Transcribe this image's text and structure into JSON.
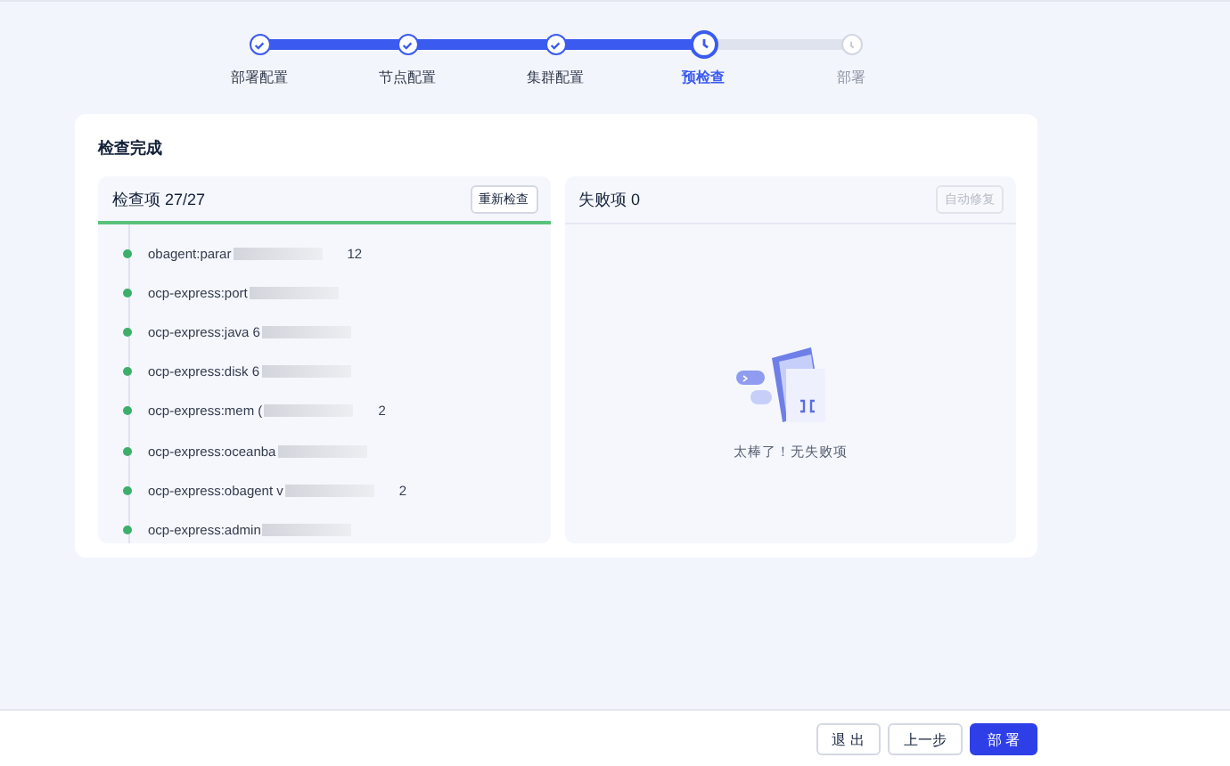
{
  "steps": [
    {
      "label": "部署配置",
      "kind": "done"
    },
    {
      "label": "节点配置",
      "kind": "done"
    },
    {
      "label": "集群配置",
      "kind": "done"
    },
    {
      "label": "预检查",
      "kind": "current"
    },
    {
      "label": "部署",
      "kind": "wait"
    }
  ],
  "card": {
    "title": "检查完成",
    "checks_panel": {
      "title": "检查项 27/27",
      "button": "重新检查",
      "level": 1,
      "items": [
        {
          "text": "obagent:parar",
          "tail": "12"
        },
        {
          "text": "ocp-express:port"
        },
        {
          "text": "ocp-express:java 6"
        },
        {
          "text": "ocp-express:disk 6"
        },
        {
          "text": "ocp-express:mem (",
          "tail": "2"
        },
        {
          "text": "ocp-express:oceanba"
        },
        {
          "text": "ocp-express:obagent v",
          "tail": "2"
        },
        {
          "text": "ocp-express:admin"
        }
      ]
    },
    "failures_panel": {
      "title": "失败项 0",
      "button": "自动修复",
      "button_disabled": true,
      "empty_text": "太棒了！无失败项"
    }
  },
  "footer": {
    "buttons": [
      {
        "label": "退 出",
        "kind": "default"
      },
      {
        "label": "上一步",
        "kind": "default"
      },
      {
        "label": "部 署",
        "kind": "primary"
      }
    ]
  }
}
